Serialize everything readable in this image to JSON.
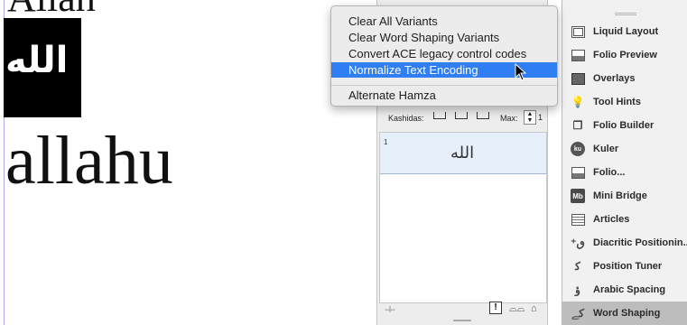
{
  "document": {
    "top_partial_text": "Allah",
    "arabic_white_text": "الله",
    "big_word": "allahu"
  },
  "context_menu": {
    "items": [
      {
        "label": "Clear All Variants",
        "highlighted": false
      },
      {
        "label": "Clear Word Shaping Variants",
        "highlighted": false
      },
      {
        "label": "Convert ACE legacy control codes",
        "highlighted": false
      },
      {
        "label": "Normalize Text Encoding",
        "highlighted": true
      }
    ],
    "after_separator": {
      "label": "Alternate Hamza"
    }
  },
  "panel": {
    "kashidas_label": "Kashidas:",
    "max_label": "Max:",
    "max_value": "1",
    "list": [
      {
        "index": "1",
        "glyph": "الله"
      }
    ],
    "bottom_warning": "!"
  },
  "dock": {
    "items": [
      {
        "label": "Liquid Layout",
        "icon": "liquid-layout-icon"
      },
      {
        "label": "Folio Preview",
        "icon": "folio-preview-icon"
      },
      {
        "label": "Overlays",
        "icon": "overlays-icon"
      },
      {
        "label": "Tool Hints",
        "icon": "tool-hints-icon"
      },
      {
        "label": "Folio Builder",
        "icon": "folio-builder-icon"
      },
      {
        "label": "Kuler",
        "icon": "kuler-icon",
        "icon_text": "ku"
      },
      {
        "label": "Folio...",
        "icon": "folio-icon"
      },
      {
        "label": "Mini Bridge",
        "icon": "mini-bridge-icon",
        "icon_text": "Mb"
      },
      {
        "label": "Articles",
        "icon": "articles-icon"
      },
      {
        "label": "Diacritic Positionin...",
        "icon": "diacritic-positioning-icon"
      },
      {
        "label": "Position Tuner",
        "icon": "position-tuner-icon"
      },
      {
        "label": "Arabic Spacing",
        "icon": "arabic-spacing-icon"
      },
      {
        "label": "Word Shaping",
        "icon": "word-shaping-icon",
        "selected": true
      }
    ]
  },
  "colors": {
    "menu_highlight": "#2f7ef2",
    "selected_dock_item": "#bdbdbd",
    "list_row_selected": "#e6f0fb"
  }
}
